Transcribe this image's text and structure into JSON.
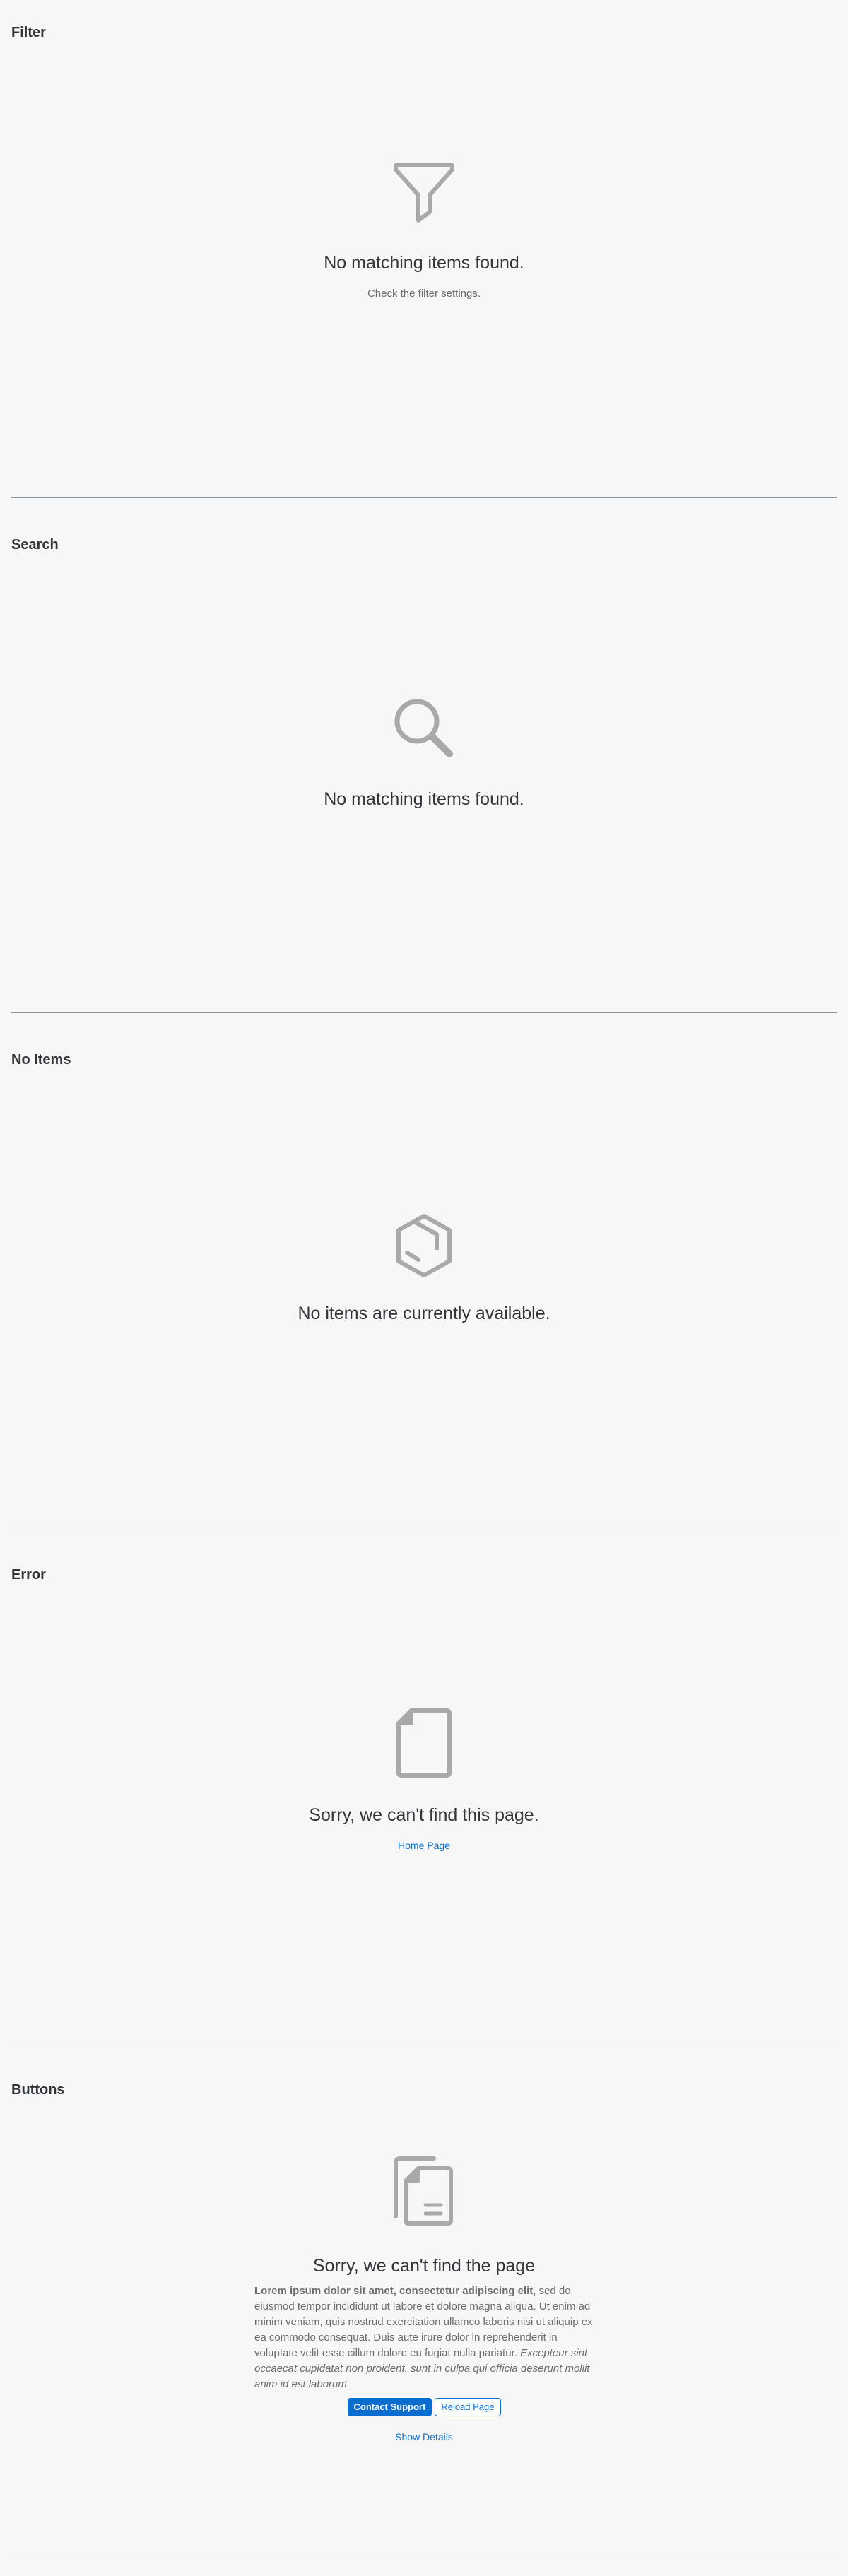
{
  "sections": {
    "filter": {
      "title": "Filter",
      "icon": "filter-icon",
      "message": "No matching items found.",
      "description": "Check the filter settings."
    },
    "search": {
      "title": "Search",
      "icon": "search-icon",
      "message": "No matching items found."
    },
    "no_items": {
      "title": "No Items",
      "icon": "box-icon",
      "message": "No items are currently available."
    },
    "error": {
      "title": "Error",
      "icon": "document-icon",
      "message": "Sorry, we can't find this page.",
      "link": "Home Page"
    },
    "buttons": {
      "title": "Buttons",
      "icon": "documents-icon",
      "message": "Sorry, we can't find the page",
      "text_bold": "Lorem ipsum dolor sit amet, consectetur adipiscing elit",
      "text_plain": ", sed do eiusmod tempor incididunt ut labore et dolore magna aliqua. Ut enim ad minim veniam, quis nostrud exercitation ullamco laboris nisi ut aliquip ex ea commodo consequat. Duis aute irure dolor in reprehenderit in voluptate velit esse cillum dolore eu fugiat nulla pariatur. ",
      "text_italic": "Excepteur sint occaecat cupidatat non proident, sunt in culpa qui officia deserunt mollit anim id est laborum.",
      "primary_button": "Contact Support",
      "secondary_button": "Reload Page",
      "details_link": "Show Details"
    }
  },
  "colors": {
    "background": "#f7f7f7",
    "text": "#32363a",
    "secondary_text": "#6a6d70",
    "accent": "#0a6ed1",
    "illustration": "#a9a9a9",
    "divider": "#89919a"
  }
}
